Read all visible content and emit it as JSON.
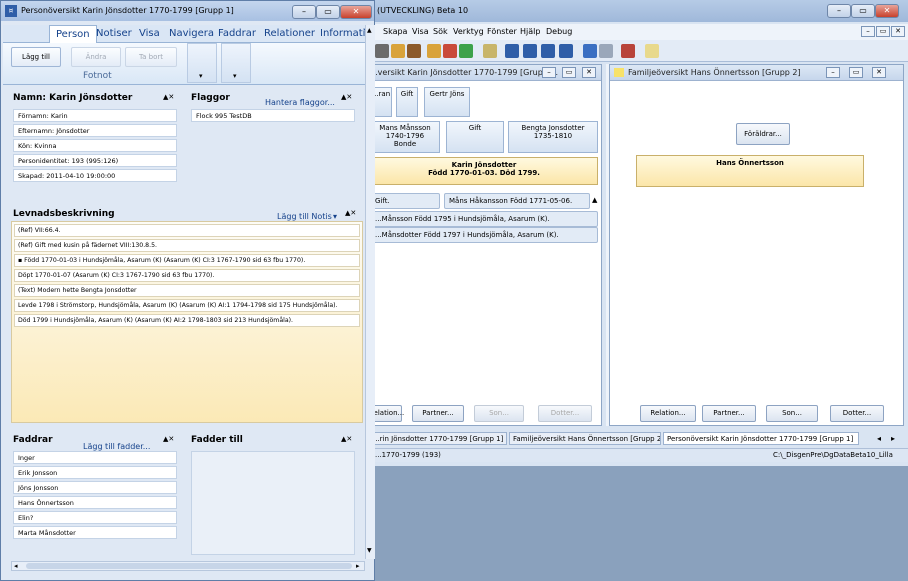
{
  "main": {
    "title": "(UTVECKLING) Beta 10",
    "caption_buttons": {
      "min": "–",
      "max": "▭",
      "close": "✕"
    },
    "menu": [
      "Skapa",
      "Visa",
      "Sök",
      "Verktyg",
      "Fönster",
      "Hjälp",
      "Debug"
    ],
    "inner_buttons": {
      "min": "–",
      "restore": "▭",
      "close": "✕"
    },
    "left_pane": {
      "title": "...versikt Karin Jönsdotter 1770-1799 [Grupp ...",
      "top_boxes": [
        "...ran",
        "Gift",
        "Gertr Jöns"
      ],
      "parent_father": {
        "line1": "Mans Månsson",
        "line2": "1740-1796",
        "line3": "Bonde"
      },
      "parent_gift": "Gift",
      "parent_mother": {
        "line1": "Bengta Jonsdotter",
        "line2": "1735-1810"
      },
      "focus": {
        "line1": "Karin Jönsdotter",
        "line2": "Född 1770-01-03. Död 1799."
      },
      "spouse_row": {
        "label": "Gift.",
        "name": "Måns Håkansson Född 1771-05-06.",
        "arrow": "▲"
      },
      "children": [
        "...Månsson Född 1795 i Hundsjömåla, Asarum (K).",
        "...Månsdotter Född 1797 i Hundsjömåla, Asarum (K)."
      ],
      "bottom_buttons": [
        "Relation...",
        "Partner...",
        "Son...",
        "Dotter..."
      ]
    },
    "right_pane": {
      "title": "Familjeöversikt Hans Önnertsson [Grupp 2]",
      "parents_button": "Föräldrar...",
      "focus": "Hans Önnertsson",
      "bottom_buttons": [
        "Relation...",
        "Partner...",
        "Son...",
        "Dotter..."
      ]
    },
    "tabs": [
      "...rin Jönsdotter 1770-1799 [Grupp 1]",
      "Familjeöversikt Hans Önnertsson [Grupp 2]",
      "Personöversikt Karin Jönsdotter 1770-1799 [Grupp 1]"
    ],
    "tab_arrows": {
      "left": "◂",
      "right": "▸"
    },
    "status_left": "...1770-1799 (193)",
    "status_right": "C:\\_DisgenPre\\DgDataBeta10_Lilla"
  },
  "person": {
    "title": "Personöversikt Karin Jönsdotter 1770-1799 [Grupp 1]",
    "title_icon": "¤",
    "caption_buttons": {
      "min": "–",
      "max": "▭",
      "close": "✕"
    },
    "ribbon_tabs": [
      "Person",
      "Notiser",
      "Visa",
      "Navigera",
      "Faddrar",
      "Relationer",
      "Informati"
    ],
    "ribbon_tab_more": "▾",
    "ribbon_buttons": [
      "Lägg till",
      "Ändra",
      "Ta bort"
    ],
    "ribbon_group": "Fotnot",
    "ribbon_split_arrows": [
      "▾",
      "▾"
    ],
    "panel_controls": "▲✕",
    "scroll_arrows": {
      "up": "▲",
      "down": "▼",
      "left": "◂",
      "right": "▸"
    },
    "name_panel": {
      "heading": "Namn: Karin Jönsdotter",
      "rows": [
        "Förnamn: Karin",
        "Efternamn: Jönsdotter",
        "Kön: Kvinna",
        "Personidentitet: 193 (995:126)",
        "Skapad: 2011-04-10 19:00:00"
      ]
    },
    "flag_panel": {
      "heading": "Flaggor",
      "link": "Hantera flaggor...",
      "rows": [
        "Flock 995 TestDB"
      ]
    },
    "levnad_panel": {
      "heading": "Levnadsbeskrivning",
      "link": "Lägg till Notis",
      "link_arrow": "▾",
      "rows": [
        "(Ref) VII:66.4.",
        "(Ref) Gift med kusin på fädernet VIII:130.8.5.",
        "  ▪  Född 1770-01-03 i Hundsjömåla, Asarum (K) (Asarum (K) CI:3 1767-1790 sid  63 fbu 1770).",
        "Döpt 1770-01-07 (Asarum (K) CI:3 1767-1790 sid  63 fbu 1770).",
        "(Text) Modern hette Bengta Jonsdotter",
        "Levde 1798 i Strömstorp, Hundsjömåla, Asarum (K) (Asarum (K) AI:1 1794-1798 sid  175 Hundsjömåla).",
        "Död 1799 i Hundsjömåla, Asarum (K) (Asarum (K) AI:2 1798-1803 sid  213 Hundsjömåla)."
      ]
    },
    "fadder_panel": {
      "heading": "Faddrar",
      "link": "Lägg till fadder...",
      "rows": [
        "Inger",
        "Erik Jonsson",
        "Jöns Jonsson",
        "Hans Önnertsson",
        "Elin?",
        "Marta Månsdotter"
      ]
    },
    "fadder_till_panel": {
      "heading": "Fadder till"
    }
  },
  "colors": {
    "accent": "#15428b",
    "focus_bg": "#fbe6a9",
    "ribbon_bg": "#dae6f5"
  }
}
